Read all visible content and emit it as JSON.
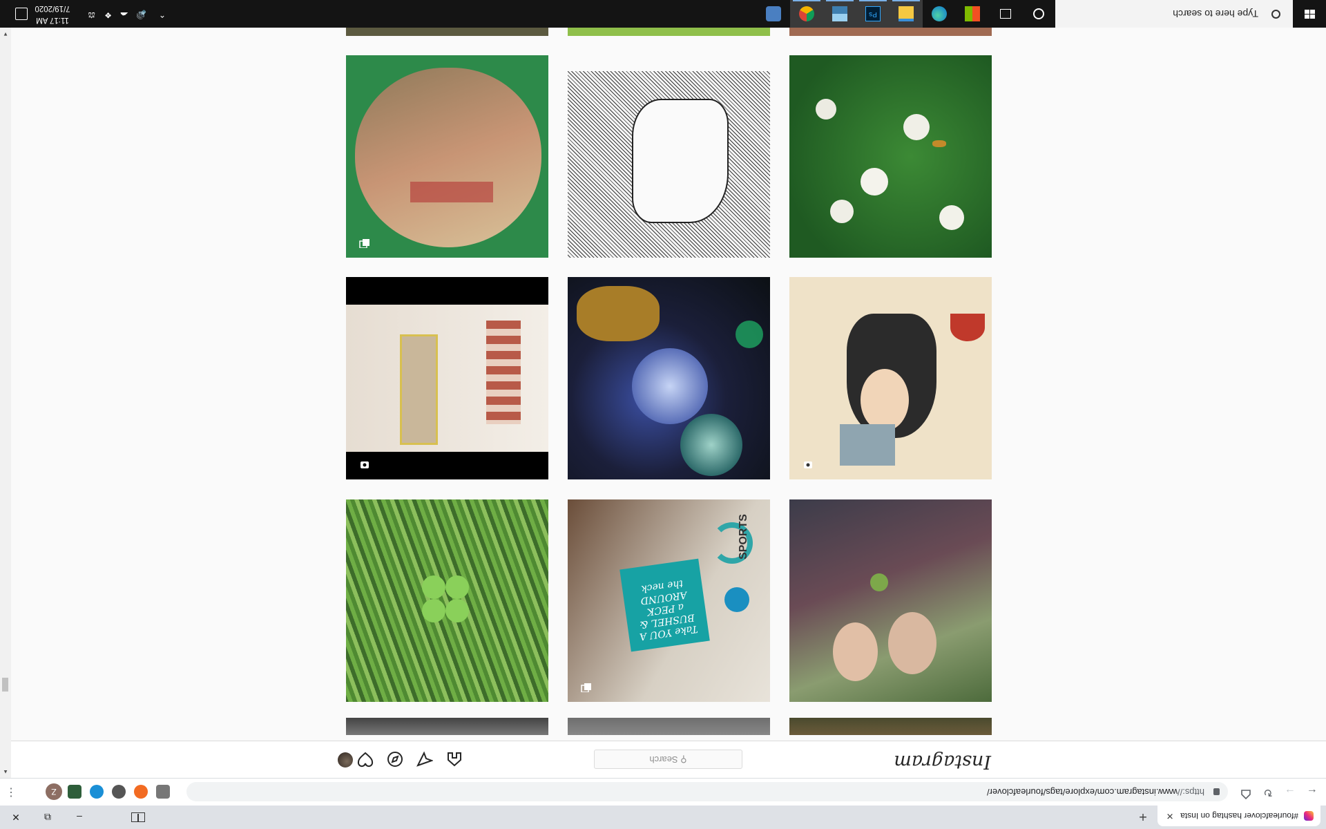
{
  "browser": {
    "tab_title": "#fourleafclover hashtag on Insta",
    "tab_close": "✕",
    "new_tab": "+",
    "url_scheme": "https://",
    "url_rest": "www.instagram.com/explore/tags/fourleafclover/",
    "profile_initial": "Z",
    "menu": "⋮"
  },
  "instagram": {
    "logo_text": "Instagram",
    "search_placeholder": "Search"
  },
  "posts": [
    {
      "description": "partial image row top",
      "badge": "none"
    },
    {
      "description": "collage mask",
      "badge": "multi"
    },
    {
      "description": "pencil hatched drawing",
      "badge": "none"
    },
    {
      "description": "white clover flowers with bee",
      "badge": "none"
    },
    {
      "description": "hallway video",
      "badge": "video"
    },
    {
      "description": "glass hourglass pendant",
      "badge": "none"
    },
    {
      "description": "sailor tattoo flash",
      "badge": "video"
    },
    {
      "description": "four leaf clover in grass",
      "badge": "none"
    },
    {
      "description": "craft collage on newspaper",
      "badge": "multi"
    },
    {
      "description": "couple selfie holding clover",
      "badge": "none"
    }
  ],
  "craft_card_text": "Take YOU A BUSHEL & a PECK AROUND the neck",
  "craft_news_text": "SPORTS",
  "taskbar": {
    "search_placeholder": "Type here to search",
    "time": "11:17 AM",
    "date": "7/19/2020"
  }
}
